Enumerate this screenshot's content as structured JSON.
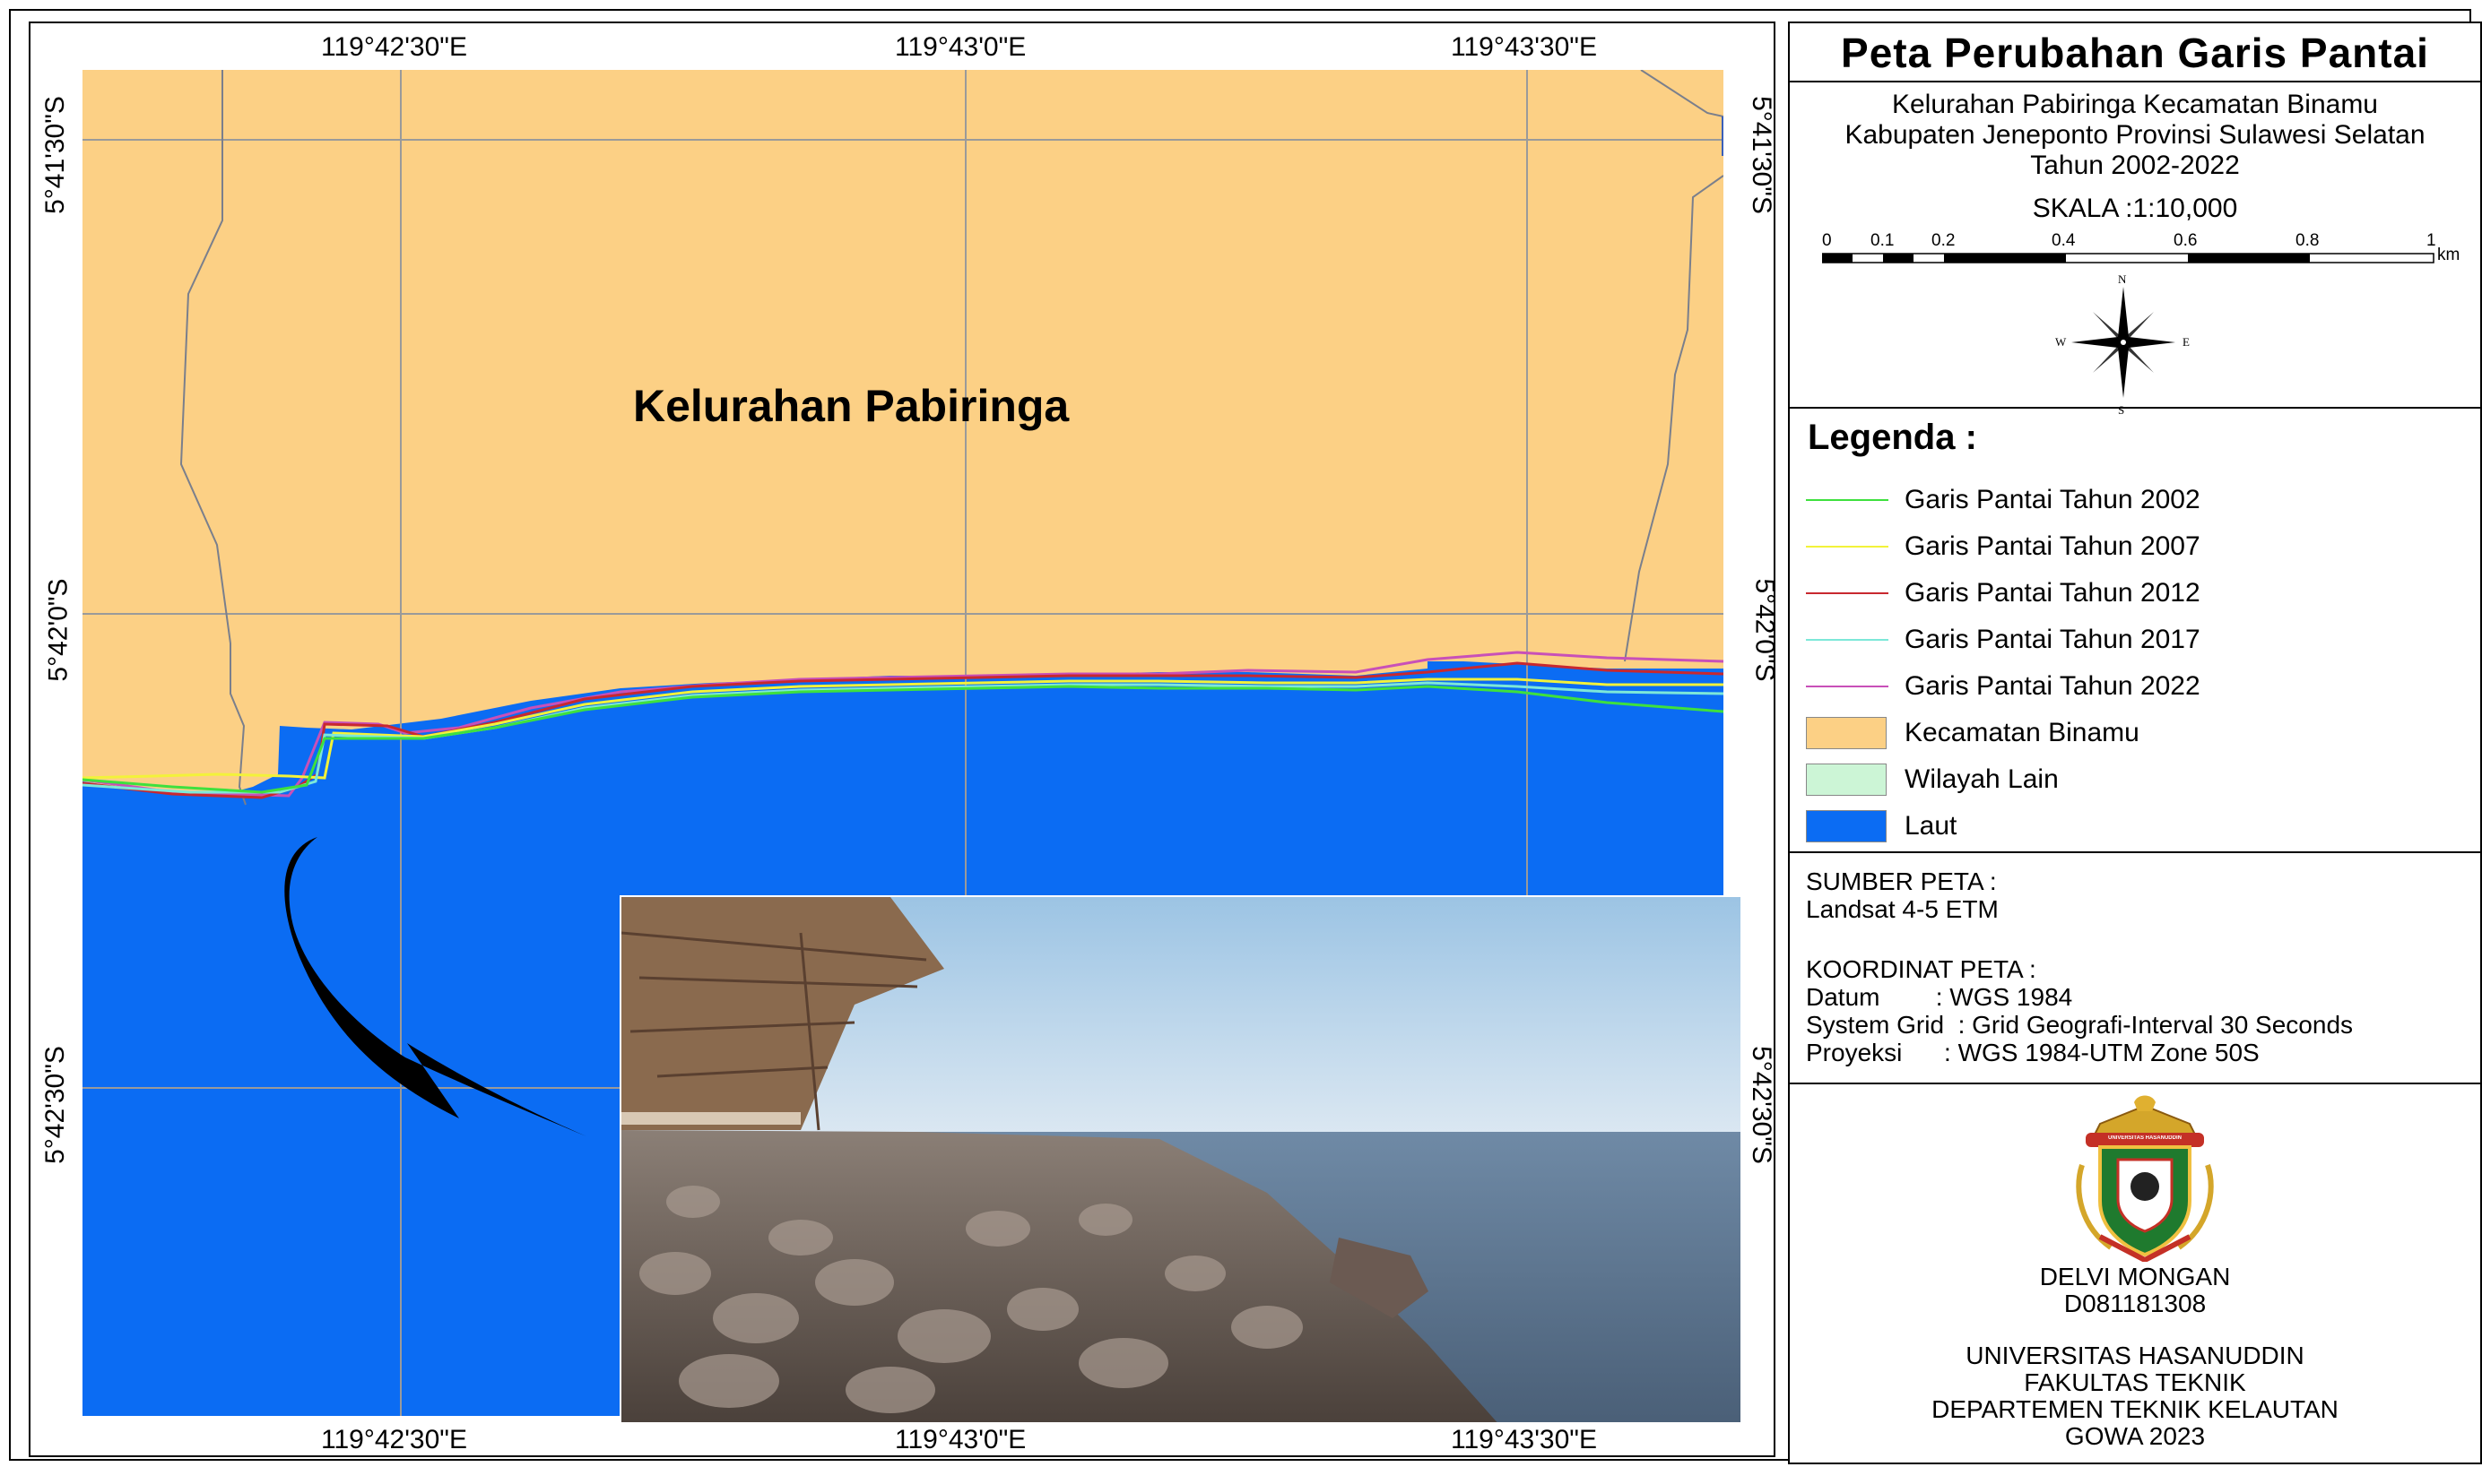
{
  "map": {
    "top_coords": [
      "119°42'30\"E",
      "119°43'0\"E",
      "119°43'30\"E"
    ],
    "bottom_coords": [
      "119°42'30\"E",
      "119°43'0\"E",
      "119°43'30\"E"
    ],
    "left_coords": [
      "5°41'30\"S",
      "5°42'0\"S",
      "5°42'30\"S"
    ],
    "right_coords": [
      "5°41'30\"S",
      "5°42'0\"S",
      "5°42'30\"S"
    ],
    "area_label": "Kelurahan Pabiringa",
    "colors": {
      "land": "#fcd085",
      "sea": "#0b6cf3",
      "grid": "#9a9a9a"
    }
  },
  "panel": {
    "title": "Peta Perubahan Garis Pantai",
    "subtitle_lines": [
      "Kelurahan Pabiringa Kecamatan Binamu",
      "Kabupaten Jeneponto Provinsi Sulawesi Selatan",
      "Tahun 2002-2022"
    ],
    "scale_label": "SKALA :1:10,000",
    "scalebar_ticks": [
      "0",
      "0.1",
      "0.2",
      "0.4",
      "0.6",
      "0.8",
      "1"
    ],
    "scalebar_unit": "km",
    "compass": {
      "n": "N",
      "s": "S",
      "e": "E",
      "w": "W"
    },
    "legend_title": "Legenda :",
    "legend": [
      {
        "label": "Garis Pantai Tahun 2002",
        "kind": "line",
        "color": "#3ee03e"
      },
      {
        "label": "Garis Pantai Tahun 2007",
        "kind": "line",
        "color": "#f2f23a"
      },
      {
        "label": "Garis Pantai Tahun 2012",
        "kind": "line",
        "color": "#c8282f"
      },
      {
        "label": "Garis Pantai Tahun 2017",
        "kind": "line",
        "color": "#7de8d8"
      },
      {
        "label": "Garis Pantai Tahun 2022",
        "kind": "line",
        "color": "#c850b8"
      },
      {
        "label": "Kecamatan Binamu",
        "kind": "box",
        "color": "#fcd085"
      },
      {
        "label": "Wilayah Lain",
        "kind": "box",
        "color": "#ccf5d6"
      },
      {
        "label": "Laut",
        "kind": "box",
        "color": "#0b6cf3"
      }
    ],
    "source_heading": "SUMBER PETA :",
    "source_value": "Landsat 4-5 ETM",
    "coord_heading": "KOORDINAT PETA :",
    "datum": "Datum        : WGS 1984",
    "system_grid": "System Grid  : Grid Geografi-Interval 30 Seconds",
    "proyeksi": "Proyeksi      : WGS 1984-UTM Zone 50S",
    "author_name": "DELVI MONGAN",
    "author_id": "D081181308",
    "institution_lines": [
      "UNIVERSITAS HASANUDDIN",
      "FAKULTAS TEKNIK",
      "DEPARTEMEN TEKNIK KELAUTAN",
      "GOWA 2023"
    ],
    "logo_text": "UNIVERSITAS HASANUDDIN"
  }
}
